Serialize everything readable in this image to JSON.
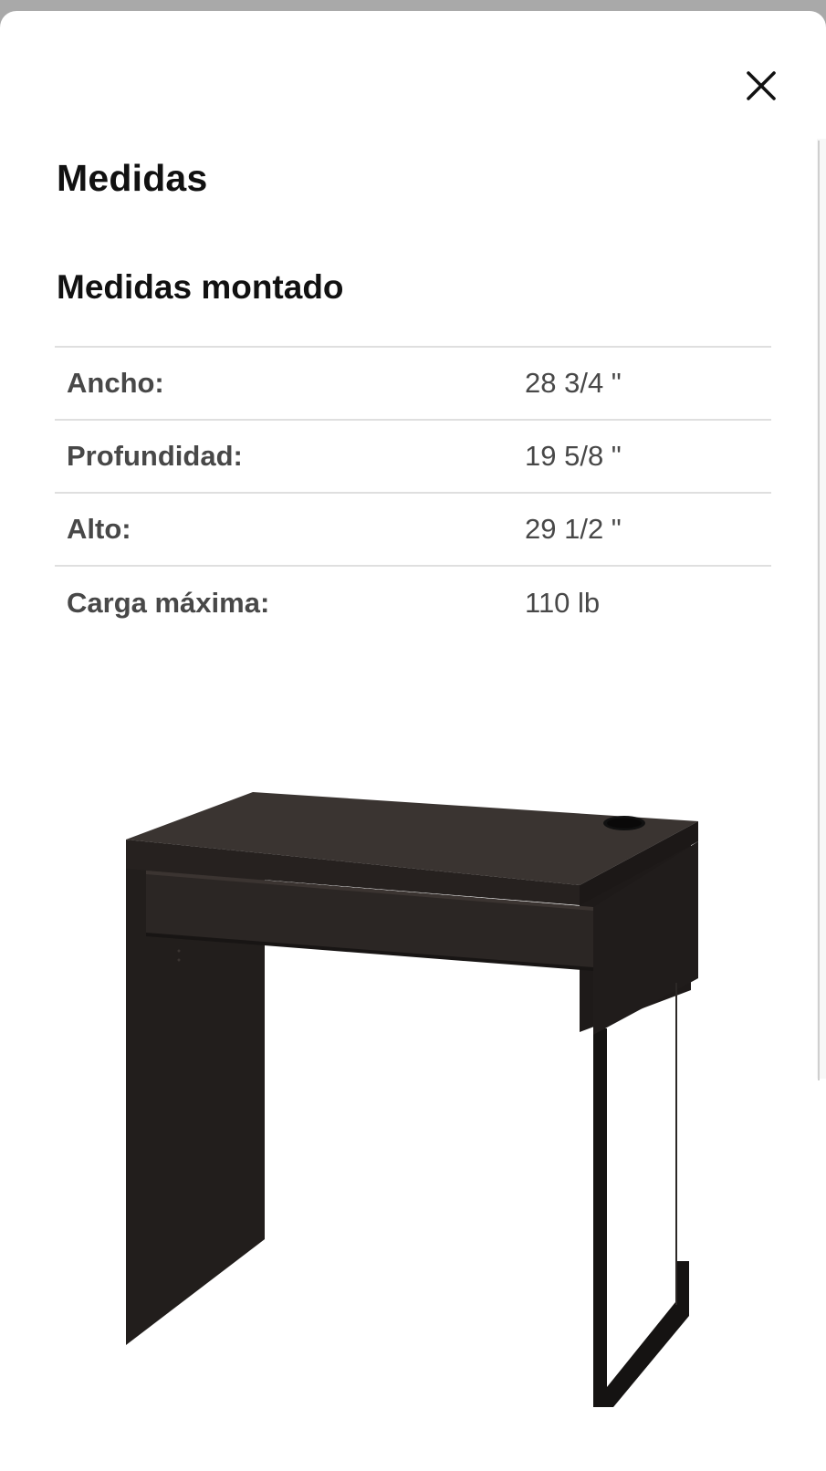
{
  "modal": {
    "close_icon": "close-icon",
    "title": "Medidas",
    "section_title": "Medidas montado"
  },
  "specs": [
    {
      "label": "Ancho:",
      "value": "28 3/4 \""
    },
    {
      "label": "Profundidad:",
      "value": "19 5/8 \""
    },
    {
      "label": "Alto:",
      "value": "29 1/2 \""
    },
    {
      "label": "Carga máxima:",
      "value": "110 lb"
    }
  ],
  "colors": {
    "backdrop": "#a9a9a9",
    "text_primary": "#111111",
    "text_secondary": "#484848",
    "divider": "#dfdfdf",
    "desk": "#2b2624"
  }
}
